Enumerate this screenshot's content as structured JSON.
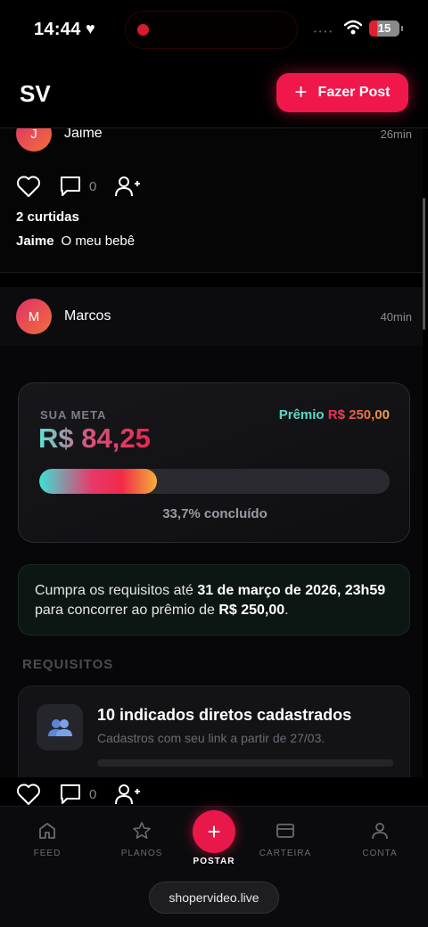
{
  "status_bar": {
    "time": "14:44",
    "battery": "15"
  },
  "header": {
    "logo": "SV",
    "post_button": "Fazer Post"
  },
  "posts": [
    {
      "avatar_initial": "J",
      "user": "Jaime",
      "time": "26min",
      "comments": "0",
      "likes": "2 curtidas",
      "caption_user": "Jaime",
      "caption_text": "O meu bebê"
    },
    {
      "avatar_initial": "M",
      "user": "Marcos",
      "time": "40min"
    }
  ],
  "goal": {
    "label": "SUA META",
    "amount": "R$ 84,25",
    "prize_label": "Prêmio",
    "prize_value": "R$ 250,00",
    "progress_fraction": 0.337,
    "progress_text": "33,7% concluído"
  },
  "notice": {
    "t1": "Cumpra os requisitos até ",
    "deadline": "31 de março de 2026, 23h59",
    "t2": " para concorrer ao prêmio de ",
    "prize": "R$ 250,00",
    "t3": "."
  },
  "requirements": {
    "title": "REQUISITOS",
    "items": [
      {
        "icon": "people-icon",
        "name": "10 indicados diretos cadastrados",
        "sub": "Cadastros com seu link a partir de 27/03."
      }
    ]
  },
  "bottom_post": {
    "comments": "0"
  },
  "nav": {
    "items": [
      {
        "label": "FEED",
        "icon": "home-icon"
      },
      {
        "label": "PLANOS",
        "icon": "star-icon"
      },
      {
        "label": "POSTAR",
        "icon": "plus-icon"
      },
      {
        "label": "CARTEIRA",
        "icon": "card-icon"
      },
      {
        "label": "CONTA",
        "icon": "person-icon"
      }
    ]
  },
  "browser": {
    "url": "shopervideo.live"
  },
  "colors": {
    "accent": "#f0184a",
    "teal": "#5ed8c4",
    "orange": "#f0a640"
  }
}
